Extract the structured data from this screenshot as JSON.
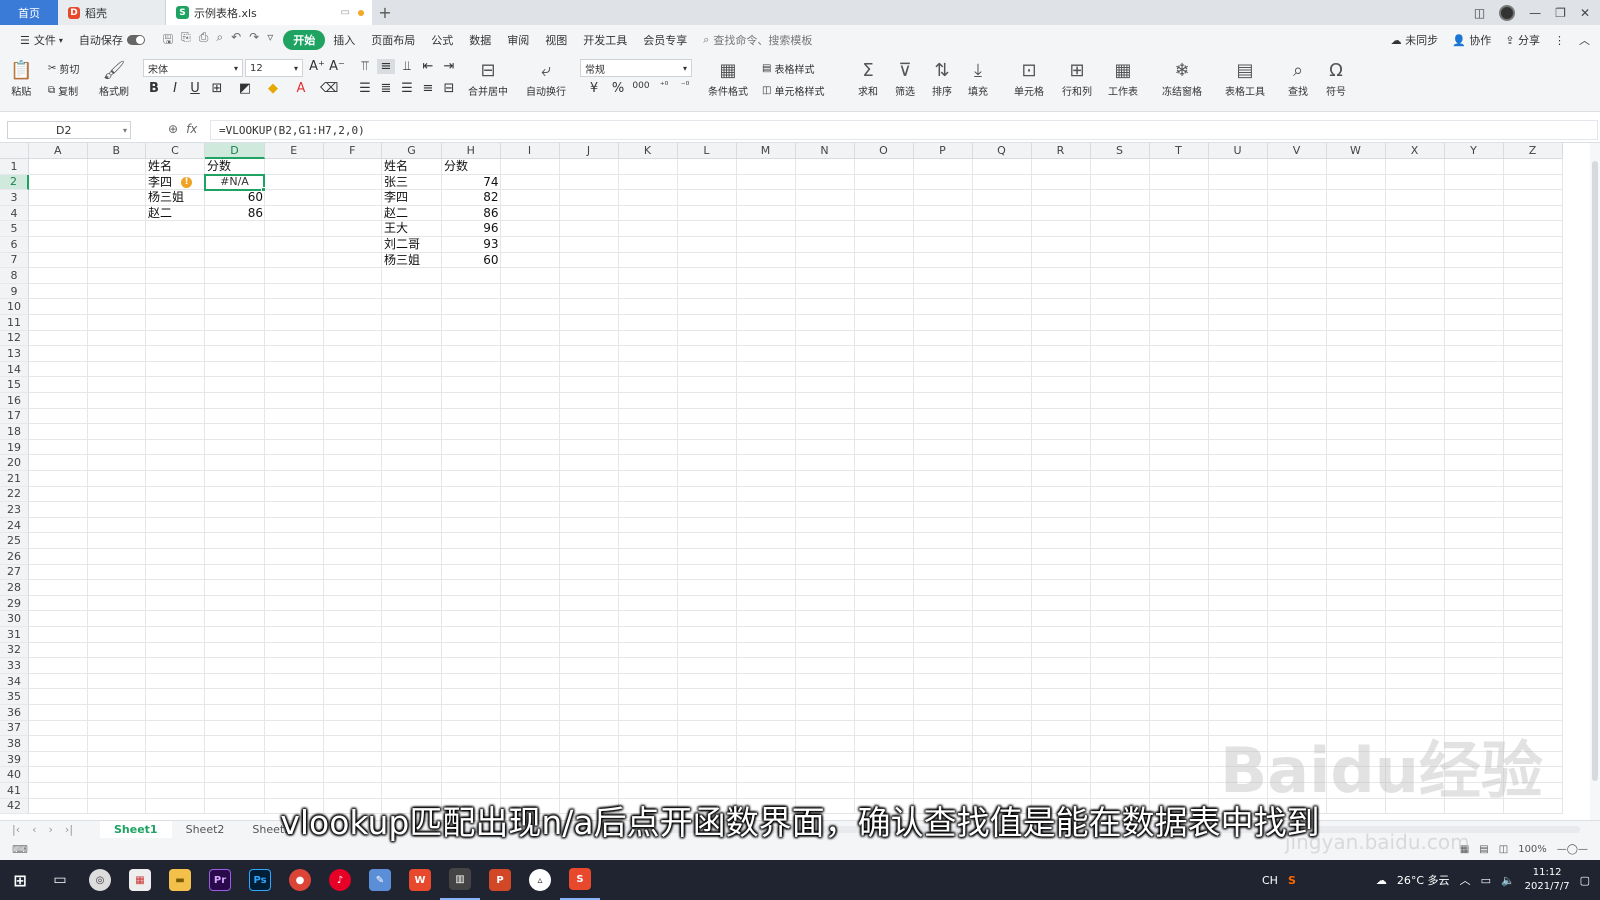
{
  "titlebar": {
    "tabs": [
      {
        "label": "首页"
      },
      {
        "label": "稻壳"
      },
      {
        "label": "示例表格.xls"
      }
    ]
  },
  "menubar": {
    "file": "文件",
    "autosave": "自动保存",
    "items": [
      "开始",
      "插入",
      "页面布局",
      "公式",
      "数据",
      "审阅",
      "视图",
      "开发工具",
      "会员专享"
    ],
    "search_placeholder": "查找命令、搜索模板",
    "right": [
      "未同步",
      "协作",
      "分享"
    ]
  },
  "ribbon": {
    "paste": "粘贴",
    "cut": "剪切",
    "copy": "复制",
    "format_painter": "格式刷",
    "font_name": "宋体",
    "font_size": "12",
    "merge_center": "合并居中",
    "wrap_text": "自动换行",
    "number_format": "常规",
    "table_style": "表格样式",
    "cell_style": "单元格样式",
    "conditional_format": "条件格式",
    "sum": "求和",
    "filter": "筛选",
    "sort": "排序",
    "fill": "填充",
    "cells": "单元格",
    "row_col": "行和列",
    "worksheet": "工作表",
    "freeze": "冻结窗格",
    "table_tools": "表格工具",
    "find": "查找",
    "symbol": "符号"
  },
  "formulabar": {
    "cell_ref": "D2",
    "formula": "=VLOOKUP(B2,G1:H7,2,0)"
  },
  "grid": {
    "columns": [
      "A",
      "B",
      "C",
      "D",
      "E",
      "F",
      "G",
      "H",
      "I",
      "J",
      "K",
      "L",
      "M",
      "N",
      "O",
      "P",
      "Q",
      "R",
      "S",
      "T",
      "U",
      "V",
      "W",
      "X",
      "Y",
      "Z"
    ],
    "rows": [
      "1",
      "2",
      "3",
      "4",
      "5",
      "6",
      "7",
      "8",
      "9",
      "10",
      "11",
      "12",
      "13",
      "14",
      "15",
      "16",
      "17",
      "18",
      "19",
      "20",
      "21",
      "22",
      "23",
      "24",
      "25",
      "26",
      "27",
      "28",
      "29",
      "30",
      "31",
      "32",
      "33",
      "34",
      "35",
      "36",
      "37",
      "38",
      "39",
      "40",
      "41",
      "42"
    ],
    "selected_column": "D",
    "selected_row": "2",
    "cells": {
      "C1": "姓名",
      "D1": "分数",
      "C2": "李四",
      "D2": "#N/A",
      "C3": "杨三姐",
      "D3": "60",
      "C4": "赵二",
      "D4": "86",
      "G1": "姓名",
      "H1": "分数",
      "G2": "张三",
      "H2": "74",
      "G3": "李四",
      "H3": "82",
      "G4": "赵二",
      "H4": "86",
      "G5": "王大",
      "H5": "96",
      "G6": "刘二哥",
      "H6": "93",
      "G7": "杨三姐",
      "H7": "60"
    }
  },
  "sheets": {
    "tabs": [
      "Sheet1",
      "Sheet2",
      "Sheet3"
    ],
    "active": "Sheet1"
  },
  "statusbar": {
    "zoom": "100%"
  },
  "subtitle": "vlookup匹配出现n/a后点开函数界面，确认查找值是能在数据表中找到",
  "watermark": {
    "text": "Baidu经验",
    "url": "jingyan.baidu.com"
  },
  "taskbar": {
    "lang": "CH",
    "weather": "26°C 多云",
    "time": "11:12",
    "date": "2021/7/7"
  }
}
